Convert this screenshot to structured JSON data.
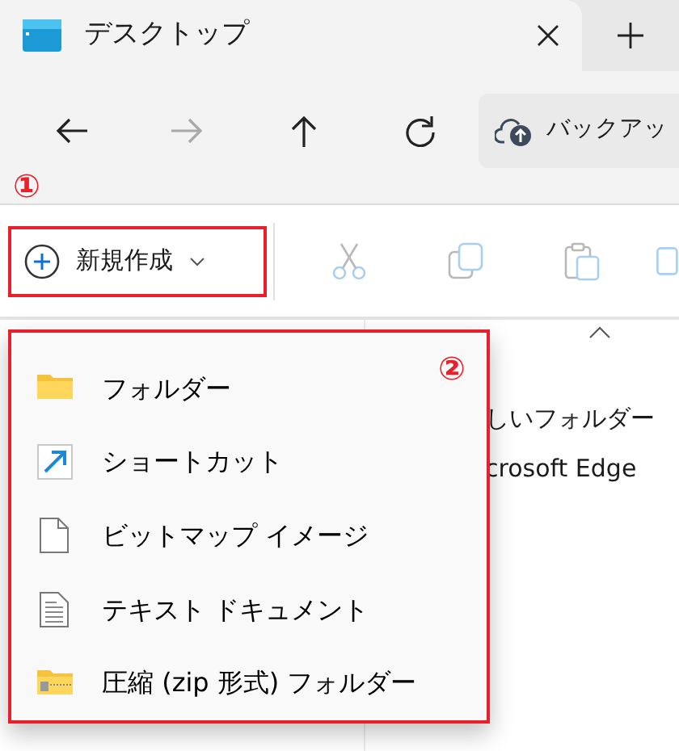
{
  "tab": {
    "title": "デスクトップ"
  },
  "nav_buttons": [
    {
      "kind": "back",
      "disabled": false
    },
    {
      "kind": "forward",
      "disabled": true
    },
    {
      "kind": "up",
      "disabled": false
    },
    {
      "kind": "refresh",
      "disabled": false
    }
  ],
  "address": {
    "text": "バックアッ"
  },
  "annotations": [
    "①",
    "②"
  ],
  "new_button": {
    "label": "新規作成"
  },
  "tools": [
    {
      "kind": "cut",
      "disabled": true
    },
    {
      "kind": "copy",
      "disabled": true
    },
    {
      "kind": "paste",
      "disabled": true
    },
    {
      "kind": "rename",
      "disabled": true
    }
  ],
  "file_list": [
    "しいフォルダー",
    "crosoft Edge"
  ],
  "menu": {
    "items": [
      {
        "kind": "folder",
        "label": "フォルダー"
      },
      {
        "kind": "shortcut",
        "label": "ショートカット"
      },
      {
        "kind": "bitmap",
        "label": "ビットマップ イメージ"
      },
      {
        "kind": "text",
        "label": "テキスト ドキュメント"
      },
      {
        "kind": "zip",
        "label": "圧縮 (zip 形式) フォルダー"
      }
    ]
  }
}
